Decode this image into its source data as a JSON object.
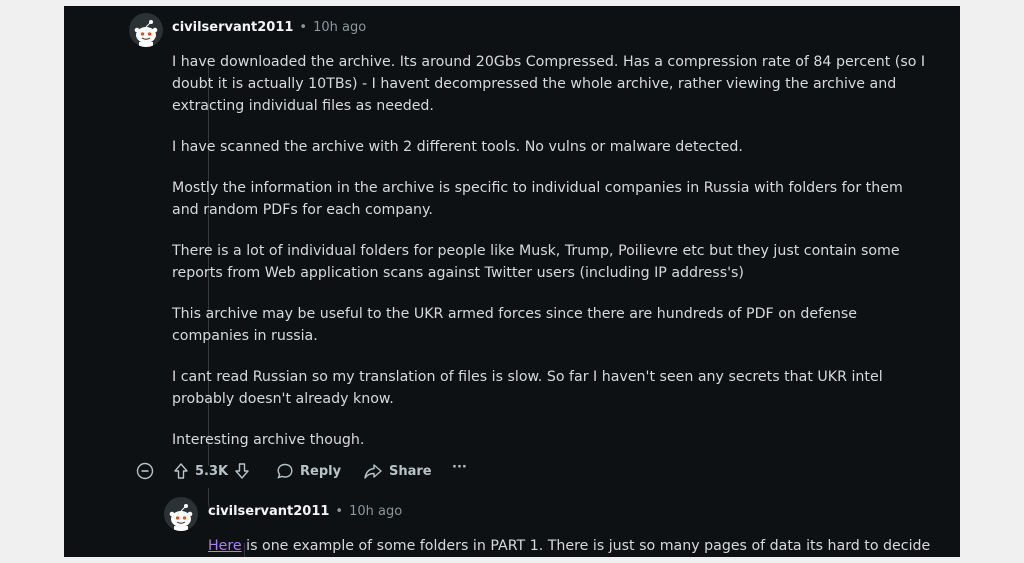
{
  "comment": {
    "username": "civilservant2011",
    "separator": "•",
    "time": "10h ago",
    "paragraphs": [
      "I have downloaded the archive. Its around 20Gbs Compressed. Has a compression rate of 84 percent (so I doubt it is actually 10TBs) - I havent decompressed the whole archive, rather viewing the archive and extracting individual files as needed.",
      "I have scanned the archive with 2 different tools. No vulns or malware detected.",
      "Mostly the information in the archive is specific to individual companies in Russia with folders for them and random PDFs for each company.",
      "There is a lot of individual folders for people like Musk, Trump, Poilievre etc but they just contain some reports from Web application scans against Twitter users (including IP address's)",
      "This archive may be useful to the UKR armed forces since there are hundreds of PDF on defense companies in russia.",
      "I cant read Russian so my translation of files is slow. So far I haven't seen any secrets that UKR intel probably doesn't already know.",
      "Interesting archive though."
    ],
    "actions": {
      "votes": "5.3K",
      "reply": "Reply",
      "share": "Share",
      "more": "···"
    }
  },
  "reply": {
    "username": "civilservant2011",
    "separator": "•",
    "time": "10h ago",
    "link_text": "Here",
    "text": " is one example of some folders in PART 1. There is just so many pages of data its hard to decide"
  },
  "colors": {
    "background": "#0e1113",
    "text": "#d7dadc",
    "link": "#b07cff",
    "muted": "#8a979c"
  }
}
